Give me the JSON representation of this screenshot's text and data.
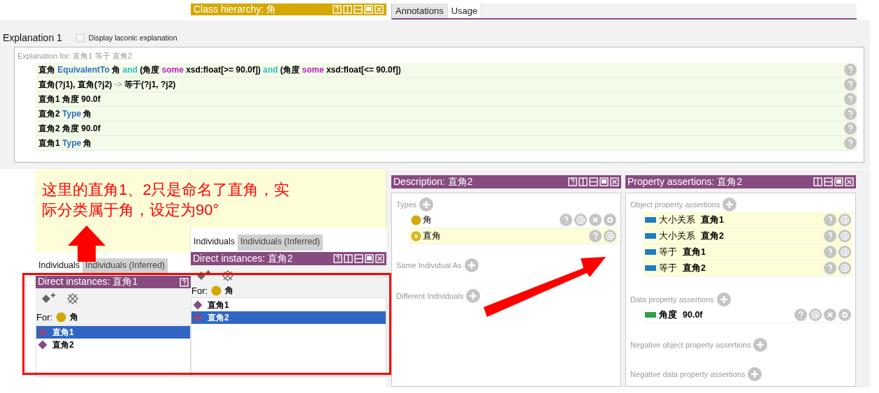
{
  "class_hierarchy": {
    "title": "Class hierarchy: 角",
    "buttons": [
      {
        "kind": "help"
      },
      {
        "kind": "split"
      },
      {
        "kind": "minimize"
      },
      {
        "kind": "maximize"
      },
      {
        "kind": "close"
      }
    ]
  },
  "top_tabs": [
    {
      "label": "Annotations",
      "selected": false
    },
    {
      "label": "Usage",
      "selected": true
    }
  ],
  "explanation": {
    "title": "Explanation 1",
    "laconic": {
      "label": "Display laconic explanation",
      "checked": false
    },
    "for_label": "Explanation for:",
    "for_text": "直角1 等于 直角2",
    "axioms": [
      {
        "parts": [
          {
            "text": "直角 ",
            "kind": "plain"
          },
          {
            "text": "EquivalentTo",
            "kind": "keyword"
          },
          {
            "text": " 角 ",
            "kind": "plain"
          },
          {
            "text": "and",
            "kind": "connective"
          },
          {
            "text": " (角度 ",
            "kind": "plain"
          },
          {
            "text": "some",
            "kind": "quantifier"
          },
          {
            "text": " xsd:float[>= 90.0f]) ",
            "kind": "plain"
          },
          {
            "text": "and",
            "kind": "connective"
          },
          {
            "text": " (角度 ",
            "kind": "plain"
          },
          {
            "text": "some",
            "kind": "quantifier"
          },
          {
            "text": " xsd:float[<= 90.0f])",
            "kind": "plain"
          }
        ]
      },
      {
        "parts": [
          {
            "text": "直角(?j1), 直角(?j2) ",
            "kind": "plain"
          },
          {
            "text": "->",
            "kind": "arrow"
          },
          {
            "text": " 等于(?j1, ?j2)",
            "kind": "plain"
          }
        ]
      },
      {
        "parts": [
          {
            "text": "直角1 角度 90.0f",
            "kind": "plain"
          }
        ]
      },
      {
        "parts": [
          {
            "text": "直角2 ",
            "kind": "plain"
          },
          {
            "text": "Type",
            "kind": "keyword"
          },
          {
            "text": " 角",
            "kind": "plain"
          }
        ]
      },
      {
        "parts": [
          {
            "text": "直角2 角度 90.0f",
            "kind": "plain"
          }
        ]
      },
      {
        "parts": [
          {
            "text": "直角1 ",
            "kind": "plain"
          },
          {
            "text": "Type",
            "kind": "keyword"
          },
          {
            "text": " 角",
            "kind": "plain"
          }
        ]
      }
    ]
  },
  "note": {
    "lines": [
      "这里的直角1、2只是命名了直角，实",
      "际分类属于角，设定为90°"
    ]
  },
  "instance_panels": [
    {
      "tabs": [
        {
          "label": "Individuals",
          "selected": true
        },
        {
          "label": "Individuals (Inferred)",
          "selected": false
        }
      ],
      "title": "Direct instances: 直角1",
      "buttons": [
        {
          "kind": "help"
        }
      ],
      "for_label": "For:",
      "for_class": "角",
      "items": [
        {
          "label": "直角1",
          "selected": true
        },
        {
          "label": "直角2",
          "selected": false
        }
      ]
    },
    {
      "tabs": [
        {
          "label": "Individuals",
          "selected": true
        },
        {
          "label": "Individuals (Inferred)",
          "selected": false
        }
      ],
      "title": "Direct instances: 直角2",
      "buttons": [
        {
          "kind": "help"
        },
        {
          "kind": "split"
        },
        {
          "kind": "minimize"
        },
        {
          "kind": "maximize"
        },
        {
          "kind": "close"
        }
      ],
      "for_label": "For:",
      "for_class": "角",
      "items": [
        {
          "label": "直角1",
          "selected": false
        },
        {
          "label": "直角2",
          "selected": true
        }
      ]
    }
  ],
  "description": {
    "title": "Description: 直角2",
    "buttons": [
      {
        "kind": "help"
      },
      {
        "kind": "split"
      },
      {
        "kind": "minimize"
      },
      {
        "kind": "maximize"
      },
      {
        "kind": "close"
      }
    ],
    "sections": [
      {
        "label": "Types",
        "items": [
          {
            "label": "角",
            "inferred": false
          },
          {
            "label": "直角",
            "inferred": true
          }
        ]
      },
      {
        "label": "Same Individual As"
      },
      {
        "label": "Different Individuals"
      }
    ]
  },
  "property_assertions": {
    "title": "Property assertions: 直角2",
    "buttons": [
      {
        "kind": "split"
      },
      {
        "kind": "minimize"
      },
      {
        "kind": "maximize"
      },
      {
        "kind": "close"
      }
    ],
    "sections": [
      {
        "label": "Object property assertions",
        "items": [
          {
            "kind": "object",
            "property": "大小关系",
            "value": "直角1",
            "inferred": true
          },
          {
            "kind": "object",
            "property": "大小关系",
            "value": "直角2",
            "inferred": true
          },
          {
            "kind": "object",
            "property": "等于",
            "value": "直角1",
            "inferred": true
          },
          {
            "kind": "object",
            "property": "等于",
            "value": "直角2",
            "inferred": true
          }
        ]
      },
      {
        "label": "Data property assertions",
        "items": [
          {
            "kind": "data",
            "property": "角度",
            "value": "90.0f",
            "inferred": false
          }
        ]
      },
      {
        "label": "Negative object property assertions"
      },
      {
        "label": "Negative data property assertions"
      }
    ]
  }
}
